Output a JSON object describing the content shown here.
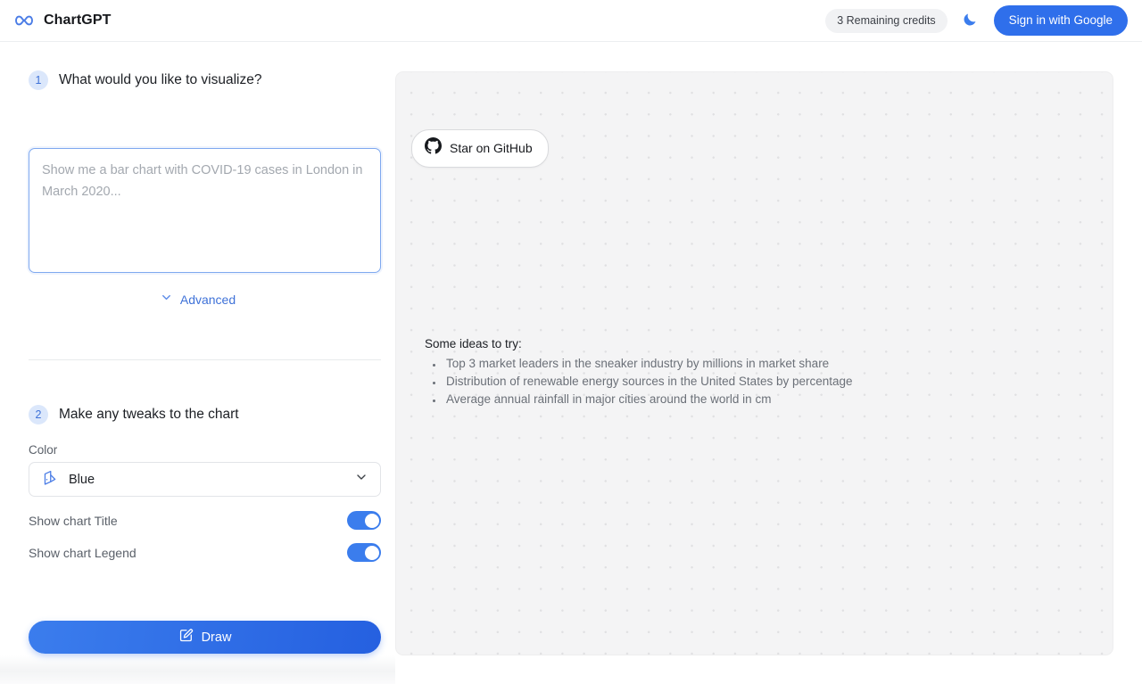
{
  "header": {
    "brand_name": "ChartGPT",
    "logo_icon": "chartgpt-logo-icon",
    "credits_label": "3 Remaining credits",
    "dark_mode_icon": "moon-icon",
    "signin_label": "Sign in with Google",
    "accent_color": "#2f6feb"
  },
  "left_panel": {
    "step1": {
      "number": "1",
      "title": "What would you like to visualize?",
      "prompt_value": "",
      "prompt_placeholder": "Show me a bar chart with COVID-19 cases in London in March 2020..."
    },
    "advanced": {
      "label": "Advanced",
      "icon": "chevron-down-icon"
    },
    "step2": {
      "number": "2",
      "title": "Make any tweaks to the chart",
      "color_field_label": "Color",
      "color_value": "Blue",
      "color_icon": "paint-bucket-icon",
      "color_chevron_icon": "chevron-down-icon",
      "color_options": [
        "Blue"
      ],
      "toggles": [
        {
          "label": "Show chart Title",
          "on": true
        },
        {
          "label": "Show chart Legend",
          "on": true
        }
      ]
    },
    "draw_button": {
      "label": "Draw",
      "icon": "pencil-square-icon"
    }
  },
  "canvas": {
    "github_button": {
      "label": "Star on GitHub",
      "icon": "github-icon"
    },
    "ideas": {
      "title": "Some ideas to try:",
      "items": [
        "Top 3 market leaders in the sneaker industry by millions in market share",
        "Distribution of renewable energy sources in the United States by percentage",
        "Average annual rainfall in major cities around the world in cm"
      ]
    },
    "background_color": "#f4f4f5",
    "dot_color": "#e0e0e2"
  }
}
